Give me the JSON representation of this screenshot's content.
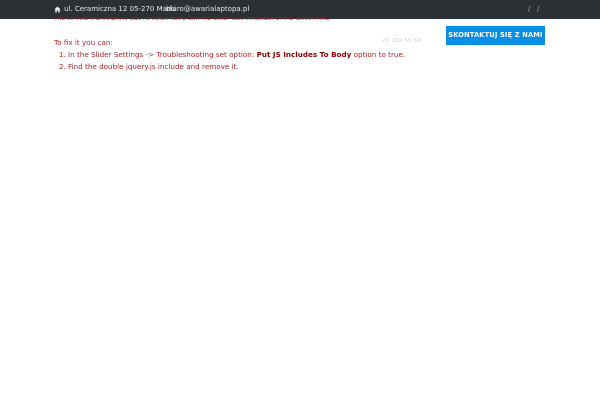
{
  "topbar": {
    "address": "ul. Ceramiczna 12 05-270 Marki",
    "email": "biuro@awarialaptopa.pl",
    "separators": [
      "/",
      "/"
    ],
    "home_icon": "home-icon"
  },
  "error": {
    "cut_line": "The include the jquery.js was included twice and the slider was initialised at the wrong time.",
    "intro": "To fix it you can:",
    "step1_before": "In the Slider Settings -> Troubleshooting set option: ",
    "step1_bold": "Put JS Includes To Body",
    "step1_after": " option to true.",
    "step2": "Find the double jquery.js include and remove it."
  },
  "version": "20 102 55 64",
  "header": {
    "contact_button": "SKONTAKTUJ SIĘ Z NAMI"
  },
  "colors": {
    "topbar_bg": "#2b3035",
    "error_red": "#b22222",
    "button_blue": "#0a8fe6"
  }
}
